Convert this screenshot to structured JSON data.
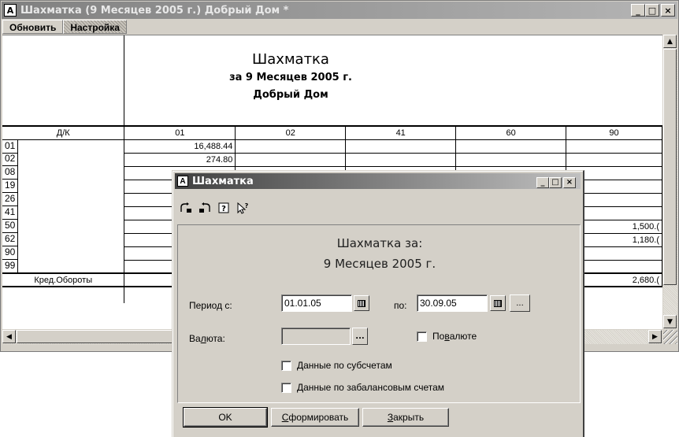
{
  "main_window": {
    "title": "Шахматка (9 Месяцев 2005 г.) Добрый Дом  *",
    "icon_letter": "A",
    "controls": {
      "minimize": "_",
      "maximize": "□",
      "close": "×"
    }
  },
  "menu": {
    "refresh": "Обновить",
    "settings": "Настройка"
  },
  "report": {
    "title": "Шахматка",
    "period": "за 9 Месяцев 2005 г.",
    "company": "Добрый Дом"
  },
  "table": {
    "corner": "Д/К",
    "columns": [
      "01",
      "02",
      "41",
      "60",
      "90"
    ],
    "rows": [
      {
        "account": "01",
        "c01": "16,488.44",
        "c90": ""
      },
      {
        "account": "02",
        "c01": "274.80",
        "c90": ""
      },
      {
        "account": "08",
        "c01": "",
        "c90": ""
      },
      {
        "account": "19",
        "c01": "",
        "c90": ""
      },
      {
        "account": "26",
        "c01": "",
        "c90": ""
      },
      {
        "account": "41",
        "c01": "",
        "c90": ""
      },
      {
        "account": "50",
        "c01": "",
        "c90": "1,500.("
      },
      {
        "account": "62",
        "c01": "",
        "c90": "1,180.("
      },
      {
        "account": "90",
        "c01": "",
        "c90": ""
      },
      {
        "account": "99",
        "c01": "",
        "c90": ""
      }
    ],
    "total": {
      "label": "Кред.Обороты",
      "c90": "2,680.("
    }
  },
  "dialog": {
    "title": "Шахматка",
    "icon_letter": "A",
    "toolbar": [
      "save-settings-icon",
      "restore-settings-icon",
      "help-icon",
      "context-help-icon"
    ],
    "heading_line1": "Шахматка за:",
    "heading_line2": "9 Месяцев 2005 г.",
    "period_from_label": "Период с:",
    "period_from_value": "01.01.05",
    "period_to_label": "по:",
    "period_to_value": "30.09.05",
    "period_more": "...",
    "currency_label_pre": "Ва",
    "currency_label_u": "л",
    "currency_label_post": "юта:",
    "currency_value": "",
    "currency_more": "...",
    "by_currency_pre": "По ",
    "by_currency_u": "в",
    "by_currency_post": "алюте",
    "subaccounts": "Данные по субсчетам",
    "offbalance": "Данные по забалансовым счетам",
    "ok": "OK",
    "generate_u": "С",
    "generate_rest": "формировать",
    "close_u": "З",
    "close_rest": "акрыть"
  }
}
